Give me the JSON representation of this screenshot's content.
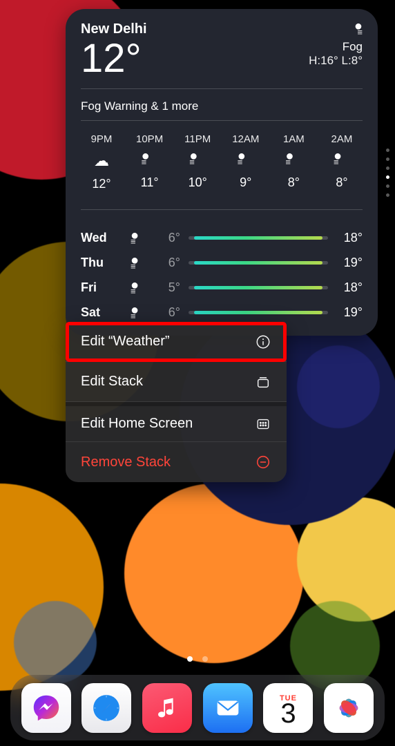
{
  "weather": {
    "location": "New Delhi",
    "current_temp": "12°",
    "condition": "Fog",
    "high_low": "H:16° L:8°",
    "alert": "Fog Warning & 1 more",
    "hourly": [
      {
        "label": "9PM",
        "temp": "12°",
        "icon": "cloud"
      },
      {
        "label": "10PM",
        "temp": "11°",
        "icon": "fog"
      },
      {
        "label": "11PM",
        "temp": "10°",
        "icon": "fog"
      },
      {
        "label": "12AM",
        "temp": "9°",
        "icon": "fog"
      },
      {
        "label": "1AM",
        "temp": "8°",
        "icon": "fog"
      },
      {
        "label": "2AM",
        "temp": "8°",
        "icon": "fog"
      }
    ],
    "daily": [
      {
        "day": "Wed",
        "lo": "6°",
        "hi": "18°"
      },
      {
        "day": "Thu",
        "lo": "6°",
        "hi": "19°"
      },
      {
        "day": "Fri",
        "lo": "5°",
        "hi": "18°"
      },
      {
        "day": "Sat",
        "lo": "6°",
        "hi": "19°"
      }
    ]
  },
  "menu": {
    "edit_widget": "Edit “Weather”",
    "edit_stack": "Edit Stack",
    "edit_homescreen": "Edit Home Screen",
    "remove_stack": "Remove Stack"
  },
  "dock": {
    "calendar_weekday": "TUE",
    "calendar_day": "3"
  }
}
